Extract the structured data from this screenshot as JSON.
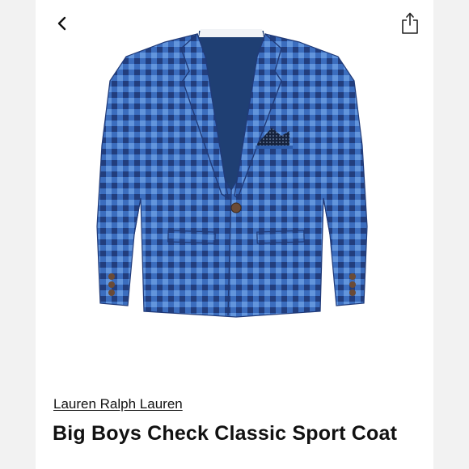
{
  "header": {
    "back_icon": "chevron-left-icon",
    "share_icon": "share-icon"
  },
  "product": {
    "image_subject": "blue checked sport coat",
    "brand": "Lauren Ralph Lauren",
    "title": "Big Boys Check Classic Sport Coat"
  },
  "colors": {
    "coat_blue": "#4a7fd0",
    "check_dark": "#203a78",
    "lining": "#1f3f73",
    "button_brown": "#6b4b36"
  }
}
